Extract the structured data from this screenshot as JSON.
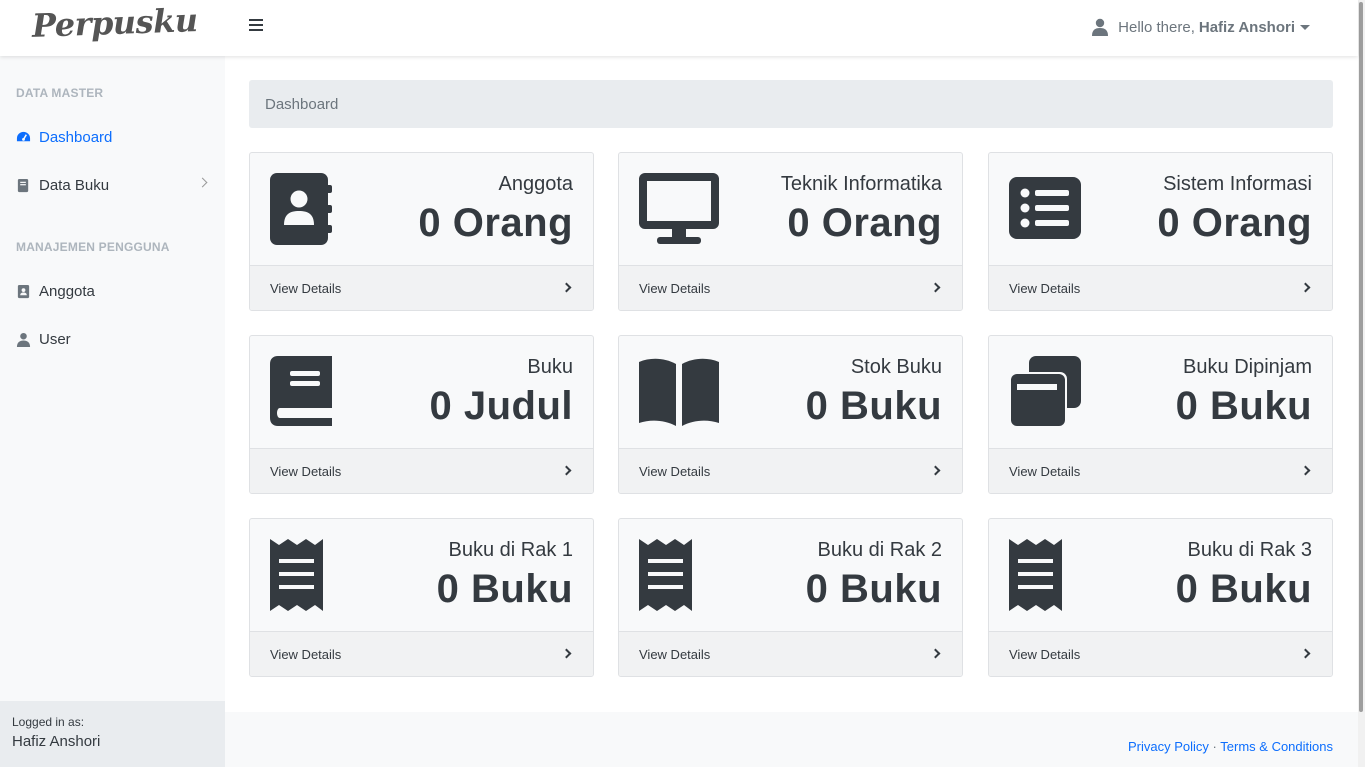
{
  "app": {
    "brand": "Perpusku"
  },
  "header": {
    "greeting": "Hello there,",
    "user_name": "Hafiz Anshori"
  },
  "sidebar": {
    "sections": [
      {
        "heading": "DATA MASTER"
      },
      {
        "heading": "MANAJEMEN PENGGUNA"
      }
    ],
    "items": [
      {
        "label": "Dashboard",
        "icon": "tachometer-icon"
      },
      {
        "label": "Data Buku",
        "icon": "book-icon"
      },
      {
        "label": "Anggota",
        "icon": "contact-icon"
      },
      {
        "label": "User",
        "icon": "user-icon"
      }
    ],
    "footer": {
      "label": "Logged in as:",
      "name": "Hafiz Anshori"
    }
  },
  "breadcrumb": "Dashboard",
  "cards": [
    {
      "title": "Anggota",
      "value": "0 Orang",
      "link": "View Details",
      "icon": "address-book-icon"
    },
    {
      "title": "Teknik Informatika",
      "value": "0 Orang",
      "link": "View Details",
      "icon": "desktop-icon"
    },
    {
      "title": "Sistem Informasi",
      "value": "0 Orang",
      "link": "View Details",
      "icon": "list-icon"
    },
    {
      "title": "Buku",
      "value": "0 Judul",
      "link": "View Details",
      "icon": "book-icon"
    },
    {
      "title": "Stok Buku",
      "value": "0 Buku",
      "link": "View Details",
      "icon": "book-open-icon"
    },
    {
      "title": "Buku Dipinjam",
      "value": "0 Buku",
      "link": "View Details",
      "icon": "clone-icon"
    },
    {
      "title": "Buku di Rak 1",
      "value": "0 Buku",
      "link": "View Details",
      "icon": "receipt-icon"
    },
    {
      "title": "Buku di Rak 2",
      "value": "0 Buku",
      "link": "View Details",
      "icon": "receipt-icon"
    },
    {
      "title": "Buku di Rak 3",
      "value": "0 Buku",
      "link": "View Details",
      "icon": "receipt-icon"
    }
  ],
  "footer": {
    "privacy": "Privacy Policy",
    "separator": "·",
    "terms": "Terms & Conditions"
  },
  "colors": {
    "accent": "#0d6efd",
    "dark": "#343a40",
    "muted": "#6c757d"
  }
}
